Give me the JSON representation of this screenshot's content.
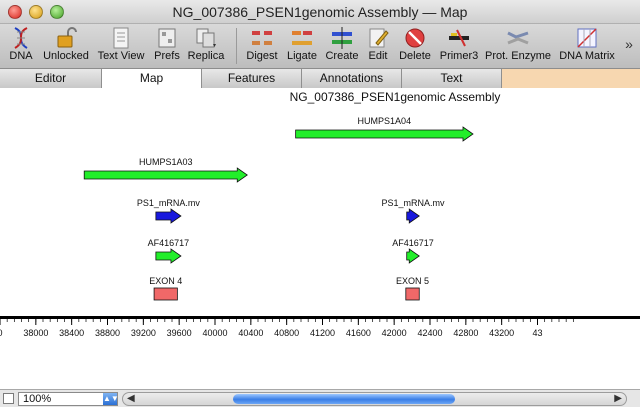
{
  "window": {
    "title": "NG_007386_PSEN1genomic Assembly — Map"
  },
  "toolbar": {
    "items": [
      {
        "label": "DNA",
        "icon": "dna-helix-icon"
      },
      {
        "label": "Unlocked",
        "icon": "unlocked-padlock-icon"
      },
      {
        "label": "Text View",
        "icon": "document-icon"
      },
      {
        "label": "Prefs",
        "icon": "preferences-icon"
      },
      {
        "label": "Replica",
        "icon": "replica-icon"
      },
      {
        "label": "Digest",
        "icon": "digest-icon"
      },
      {
        "label": "Ligate",
        "icon": "ligate-icon"
      },
      {
        "label": "Create",
        "icon": "create-icon"
      },
      {
        "label": "Edit",
        "icon": "edit-pencil-icon"
      },
      {
        "label": "Delete",
        "icon": "delete-icon"
      },
      {
        "label": "Primer3",
        "icon": "primer3-icon"
      },
      {
        "label": "Prot. Enzyme",
        "icon": "protein-enzyme-icon"
      },
      {
        "label": "DNA Matrix",
        "icon": "dna-matrix-icon"
      }
    ],
    "overflow": "»"
  },
  "tabs": [
    {
      "label": "Editor",
      "active": false
    },
    {
      "label": "Map",
      "active": true
    },
    {
      "label": "Features",
      "active": false
    },
    {
      "label": "Annotations",
      "active": false
    },
    {
      "label": "Text",
      "active": false
    }
  ],
  "map": {
    "title": "NG_007386_PSEN1genomic Assembly",
    "features": [
      {
        "name": "HUMPS1A04",
        "start": 40900,
        "end": 42880,
        "color": "#22ee2a"
      },
      {
        "name": "HUMPS1A03",
        "start": 38540,
        "end": 40360,
        "color": "#22ee2a"
      },
      {
        "name": "PS1_mRNA.mv",
        "start": 39340,
        "end": 39620,
        "color": "#1818dd"
      },
      {
        "name": "PS1_mRNA.mv",
        "start": 42140,
        "end": 42280,
        "color": "#1818dd"
      },
      {
        "name": "AF416717",
        "start": 39340,
        "end": 39620,
        "color": "#22ee2a"
      },
      {
        "name": "AF416717",
        "start": 42140,
        "end": 42280,
        "color": "#22ee2a"
      },
      {
        "name": "EXON 4",
        "start": 39320,
        "end": 39580,
        "color": "#f06868"
      },
      {
        "name": "EXON 5",
        "start": 42130,
        "end": 42280,
        "color": "#f06868"
      }
    ],
    "ruler": {
      "ticks": [
        37600,
        38000,
        38400,
        38800,
        39200,
        39600,
        40000,
        40400,
        40800,
        41200,
        41600,
        42000,
        42400,
        42800,
        43200,
        43600
      ],
      "tick_labels": [
        "0",
        "38000",
        "38400",
        "38800",
        "39200",
        "39600",
        "40000",
        "40400",
        "40800",
        "41200",
        "41600",
        "42000",
        "42400",
        "42800",
        "43200",
        "43"
      ]
    }
  },
  "status": {
    "zoom": "100%"
  }
}
